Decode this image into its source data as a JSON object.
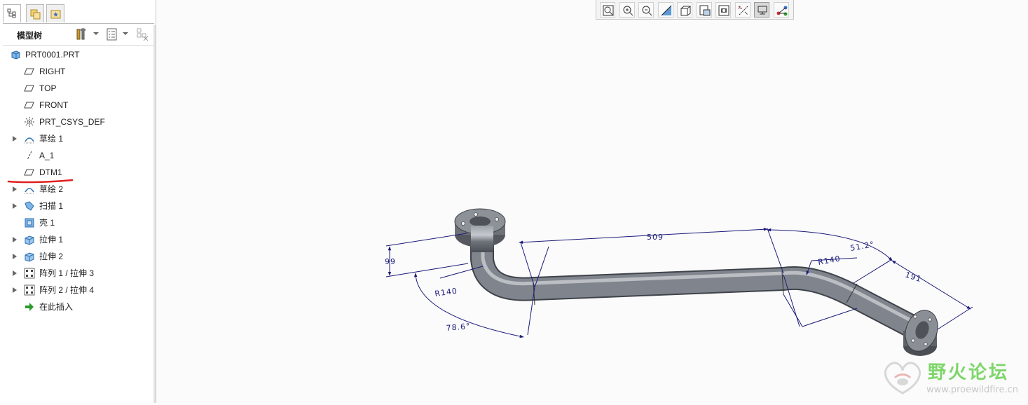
{
  "panel": {
    "tabs": [
      {
        "icon": "model-tree-icon"
      },
      {
        "icon": "folder-browser-icon"
      },
      {
        "icon": "favorites-icon"
      }
    ],
    "title": "模型树",
    "toolbar_icons": [
      "settings-tools-icon",
      "show-options-icon",
      "filter-icon"
    ]
  },
  "tree": {
    "items": [
      {
        "label": "PRT0001.PRT",
        "icon": "part-icon",
        "expandable": false
      },
      {
        "label": "RIGHT",
        "icon": "datum-plane-icon",
        "expandable": false
      },
      {
        "label": "TOP",
        "icon": "datum-plane-icon",
        "expandable": false
      },
      {
        "label": "FRONT",
        "icon": "datum-plane-icon",
        "expandable": false
      },
      {
        "label": "PRT_CSYS_DEF",
        "icon": "csys-icon",
        "expandable": false
      },
      {
        "label": "草绘 1",
        "icon": "sketch-icon",
        "expandable": true
      },
      {
        "label": "A_1",
        "icon": "axis-icon",
        "expandable": false
      },
      {
        "label": "DTM1",
        "icon": "datum-plane-icon",
        "expandable": false,
        "highlighted": true
      },
      {
        "label": "草绘 2",
        "icon": "sketch-icon",
        "expandable": true
      },
      {
        "label": "扫描 1",
        "icon": "sweep-icon",
        "expandable": true
      },
      {
        "label": "壳 1",
        "icon": "shell-icon",
        "expandable": false
      },
      {
        "label": "拉伸 1",
        "icon": "extrude-icon",
        "expandable": true
      },
      {
        "label": "拉伸 2",
        "icon": "extrude-icon",
        "expandable": true
      },
      {
        "label": "阵列 1 / 拉伸 3",
        "icon": "pattern-icon",
        "expandable": true
      },
      {
        "label": "阵列 2 / 拉伸 4",
        "icon": "pattern-icon",
        "expandable": true
      },
      {
        "label": "在此插入",
        "icon": "insert-here-icon",
        "expandable": false
      }
    ]
  },
  "graphics_toolbar": {
    "buttons": [
      {
        "name": "refit-icon"
      },
      {
        "name": "zoom-in-icon"
      },
      {
        "name": "zoom-out-icon"
      },
      {
        "name": "repaint-icon"
      },
      {
        "name": "display-style-icon"
      },
      {
        "name": "saved-views-icon"
      },
      {
        "name": "view-manager-icon"
      },
      {
        "name": "datum-display-icon"
      },
      {
        "name": "annotation-display-icon",
        "active": true
      },
      {
        "name": "spin-center-icon"
      }
    ]
  },
  "dimensions": {
    "d509": "509",
    "d51_2": "51.2°",
    "d191": "191",
    "d99": "99",
    "r140_left": "R140",
    "r140_right": "R140",
    "a78_6": "78.6°"
  },
  "watermark": {
    "title": "野火论坛",
    "url": "www.proewildfire.cn"
  },
  "colors": {
    "dimension": "#1a1a7a",
    "pipe": "#6b6f76",
    "annotation_underline": "#e02020",
    "watermark": "#7ed66a"
  }
}
